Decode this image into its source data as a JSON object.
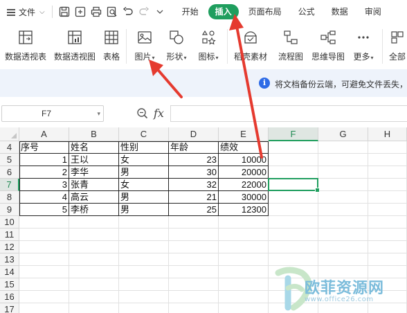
{
  "menubar": {
    "file_label": "文件",
    "tabs": [
      {
        "label": "开始"
      },
      {
        "label": "插入",
        "active": true
      },
      {
        "label": "页面布局"
      },
      {
        "label": "公式"
      },
      {
        "label": "数据"
      },
      {
        "label": "审阅"
      }
    ]
  },
  "ribbon": {
    "pivot_table": "数据透视表",
    "pivot_chart": "数据透视图",
    "table": "表格",
    "picture": "图片",
    "shape": "形状",
    "icon": "图标",
    "material": "稻壳素材",
    "flowchart": "流程图",
    "mindmap": "思维导图",
    "more": "更多",
    "all": "全部"
  },
  "notice": {
    "text": "将文档备份云端，可避免文件丢失，"
  },
  "formula_bar": {
    "name_box": "F7",
    "fx": "fx",
    "formula": ""
  },
  "grid": {
    "columns": [
      "A",
      "B",
      "C",
      "D",
      "E",
      "F",
      "G",
      "H"
    ],
    "selected_column": "F",
    "rows": [
      {
        "num": "4",
        "cells": [
          "序号",
          "姓名",
          "性别",
          "年龄",
          "绩效",
          "",
          "",
          ""
        ]
      },
      {
        "num": "5",
        "cells": [
          "1",
          "王以",
          "女",
          "23",
          "10000",
          "",
          "",
          ""
        ]
      },
      {
        "num": "6",
        "cells": [
          "2",
          "李华",
          "男",
          "30",
          "20000",
          "",
          "",
          ""
        ]
      },
      {
        "num": "7",
        "cells": [
          "3",
          "张青",
          "女",
          "32",
          "22000",
          "",
          "",
          ""
        ]
      },
      {
        "num": "8",
        "cells": [
          "4",
          "高云",
          "男",
          "21",
          "30000",
          "",
          "",
          ""
        ]
      },
      {
        "num": "9",
        "cells": [
          "5",
          "李桥",
          "男",
          "25",
          "12300",
          "",
          "",
          ""
        ]
      },
      {
        "num": "10",
        "cells": [
          "",
          "",
          "",
          "",
          "",
          "",
          "",
          ""
        ]
      },
      {
        "num": "11",
        "cells": [
          "",
          "",
          "",
          "",
          "",
          "",
          "",
          ""
        ]
      },
      {
        "num": "12",
        "cells": [
          "",
          "",
          "",
          "",
          "",
          "",
          "",
          ""
        ]
      },
      {
        "num": "13",
        "cells": [
          "",
          "",
          "",
          "",
          "",
          "",
          "",
          ""
        ]
      },
      {
        "num": "14",
        "cells": [
          "",
          "",
          "",
          "",
          "",
          "",
          "",
          ""
        ]
      },
      {
        "num": "15",
        "cells": [
          "",
          "",
          "",
          "",
          "",
          "",
          "",
          ""
        ]
      },
      {
        "num": "16",
        "cells": [
          "",
          "",
          "",
          "",
          "",
          "",
          "",
          ""
        ]
      },
      {
        "num": "17",
        "cells": [
          "",
          "",
          "",
          "",
          "",
          "",
          "",
          ""
        ]
      }
    ],
    "selected_row": "7"
  },
  "watermark": {
    "name": "欧菲资源网",
    "url": "www.office26.com"
  },
  "colors": {
    "accent": "#1f9e5e",
    "annotation": "#e53a2f",
    "info": "#2d6be6"
  }
}
